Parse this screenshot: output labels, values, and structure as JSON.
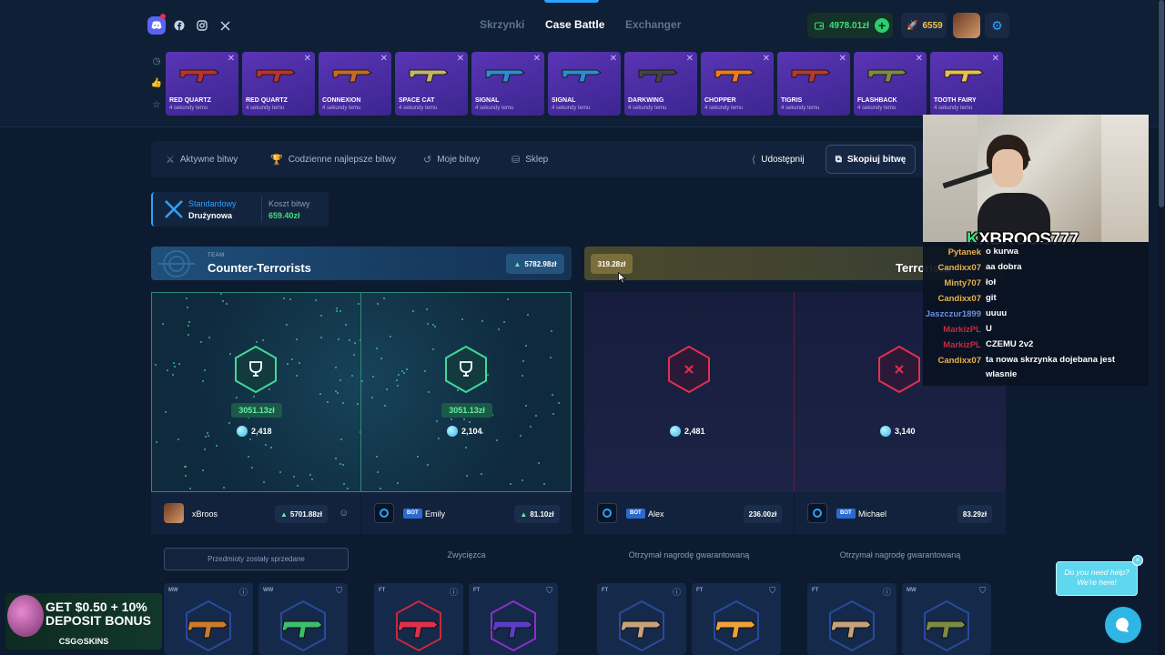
{
  "header": {
    "social": [
      {
        "name": "discord-icon"
      },
      {
        "name": "facebook-icon"
      },
      {
        "name": "instagram-icon"
      },
      {
        "name": "x-icon"
      }
    ],
    "nav": [
      {
        "label": "Skrzynki",
        "active": false
      },
      {
        "label": "Case Battle",
        "active": true
      },
      {
        "label": "Exchanger",
        "active": false
      }
    ],
    "balance": "4978.01zł",
    "coins": "6559"
  },
  "drops": [
    {
      "name": "RED QUARTZ",
      "time": "4 sekundy temu"
    },
    {
      "name": "RED QUARTZ",
      "time": "4 sekundy temu"
    },
    {
      "name": "CONNEXION",
      "time": "4 sekundy temu"
    },
    {
      "name": "SPACE CAT",
      "time": "4 sekundy temu"
    },
    {
      "name": "SIGNAL",
      "time": "4 sekundy temu"
    },
    {
      "name": "SIGNAL",
      "time": "4 sekundy temu"
    },
    {
      "name": "DARKWING",
      "time": "4 sekundy temu"
    },
    {
      "name": "CHOPPER",
      "time": "4 sekundy temu"
    },
    {
      "name": "TIGRIS",
      "time": "4 sekundy temu"
    },
    {
      "name": "FLASHBACK",
      "time": "4 sekundy temu"
    },
    {
      "name": "TOOTH FAIRY",
      "time": "4 sekundy temu"
    }
  ],
  "actions": {
    "active": "Aktywne bitwy",
    "daily": "Codzienne najlepsze bitwy",
    "mine": "Moje bitwy",
    "shop": "Sklep",
    "share": "Udostępnij",
    "copy": "Skopiuj bitwę"
  },
  "mode": {
    "type": "Standardowy",
    "subtype": "Drużynowa",
    "cost_label": "Koszt bitwy",
    "cost": "659.40zł"
  },
  "teams": {
    "ct": {
      "tag": "TEAM",
      "name": "Counter-Terrorists",
      "value": "5782.98zł"
    },
    "t": {
      "tag": "TEAM",
      "name": "Terrorists",
      "value": "319.28zł"
    }
  },
  "arena": [
    {
      "prize": "3051.13zł",
      "count": "2,418",
      "state": "win"
    },
    {
      "prize": "3051.13zł",
      "count": "2,104",
      "state": "win"
    },
    {
      "prize": "",
      "count": "2,481",
      "state": "lose"
    },
    {
      "prize": "",
      "count": "3,140",
      "state": "lose"
    }
  ],
  "players": [
    {
      "name": "xBroos",
      "bot": "",
      "value": "5701.88zł",
      "status": "Przedmioty zostały sprzedane"
    },
    {
      "name": "Emily",
      "bot": "BOT",
      "value": "81.10zł",
      "status": "Zwycięzca"
    },
    {
      "name": "Alex",
      "bot": "BOT",
      "value": "236.00zł",
      "status": "Otrzymał nagrodę gwarantowaną"
    },
    {
      "name": "Michael",
      "bot": "BOT",
      "value": "83.29zł",
      "status": "Otrzymał nagrodę gwarantowaną"
    }
  ],
  "item_qualities": [
    "MW",
    "WW",
    "FT",
    "FT",
    "FT",
    "FT",
    "FT",
    "MW"
  ],
  "stream": {
    "streamer": "XBROOS777",
    "chat": [
      {
        "user": "Pytanek",
        "msg": "o kurwa",
        "color": "#e8b24a"
      },
      {
        "user": "Candixx07",
        "msg": "aa dobra",
        "color": "#e8b24a"
      },
      {
        "user": "Minty707",
        "msg": "łoł",
        "color": "#e8b24a"
      },
      {
        "user": "Candixx07",
        "msg": "git",
        "color": "#e8b24a"
      },
      {
        "user": "Jaszczur1899",
        "msg": "uuuu",
        "color": "#6d8fe0"
      },
      {
        "user": "MarkizPL",
        "msg": "U",
        "color": "#c9283e"
      },
      {
        "user": "MarkizPL",
        "msg": "CZEMU 2v2",
        "color": "#c9283e"
      },
      {
        "user": "Candixx07",
        "msg": "ta nowa skrzynka dojebana jest wlasnie",
        "color": "#e8b24a"
      }
    ]
  },
  "promo": {
    "line1": "GET $0.50 + 10%",
    "line2": "DEPOSIT BONUS",
    "brand": "CSG⊙SKINS"
  },
  "help": {
    "text1": "Do you need help?",
    "text2": "We're here!"
  },
  "colors": {
    "accent": "#2ba3ff",
    "green": "#3ee07a",
    "red": "#e0304e"
  }
}
